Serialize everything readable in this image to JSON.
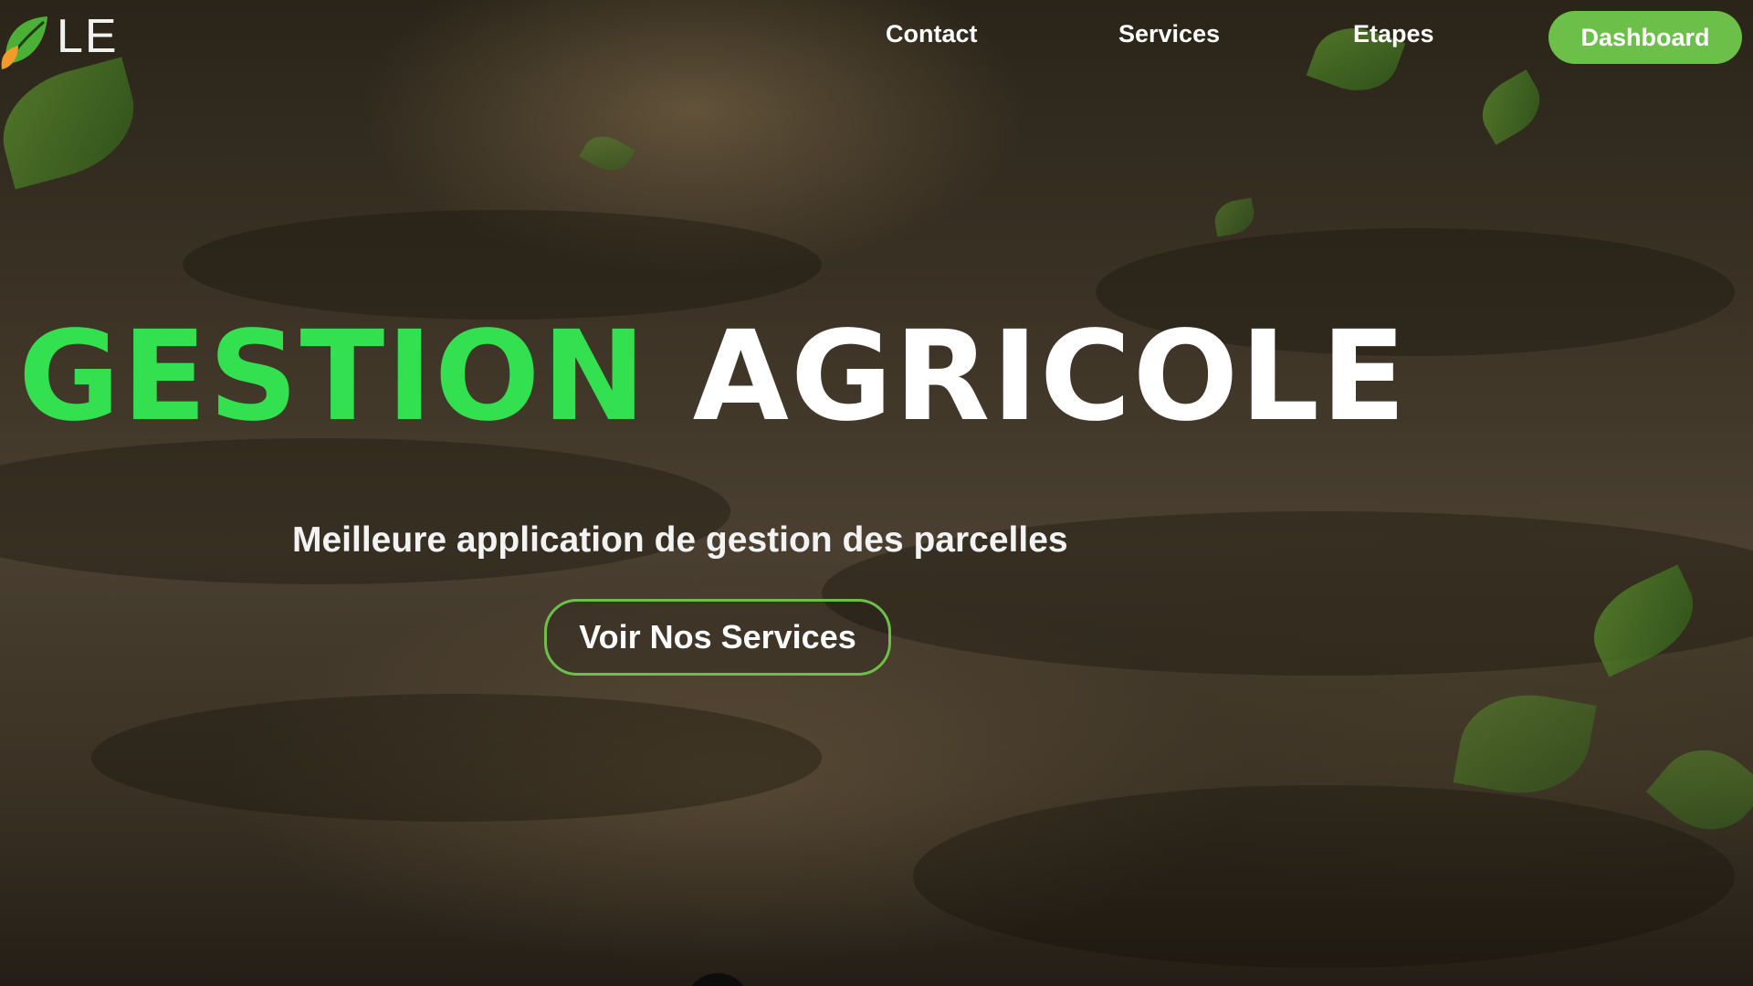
{
  "header": {
    "logo_text": "LE",
    "nav": [
      {
        "label": "Contact"
      },
      {
        "label": "Services"
      },
      {
        "label": "Etapes"
      }
    ],
    "dashboard_label": "Dashboard"
  },
  "hero": {
    "title_green": "GESTION",
    "title_white": "AGRICOLE",
    "subtitle": "Meilleure application de gestion des parcelles",
    "cta_label": "Voir Nos Services"
  },
  "colors": {
    "accent_green": "#33e04f",
    "button_green": "#6cc04a",
    "text_white": "#ffffff"
  }
}
